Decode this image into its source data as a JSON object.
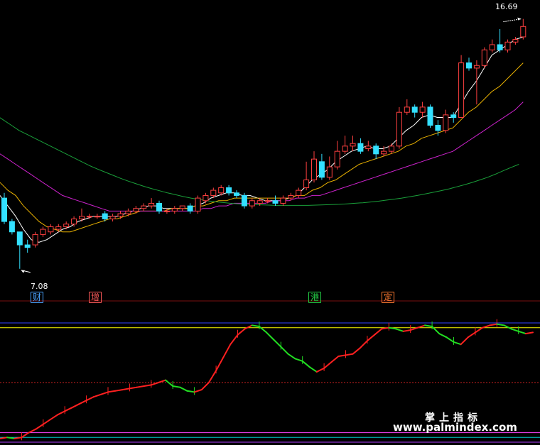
{
  "labels": {
    "high_price": "16.69",
    "low_price": "7.08"
  },
  "tags": [
    {
      "text": "财",
      "color": "#4aa3ff"
    },
    {
      "text": "增",
      "color": "#ff5a5a"
    },
    {
      "text": "港",
      "color": "#22cc44"
    },
    {
      "text": "定",
      "color": "#ff7a30"
    }
  ],
  "watermark": {
    "line1": "掌上指标",
    "line2": "www.palmindex.com"
  },
  "colors": {
    "up": "#ff4040",
    "down": "#33e0ff",
    "ma5": "#ffffff",
    "ma10": "#e8b000",
    "ma20": "#cc22cc",
    "ma60": "#1aa03a",
    "osc_up": "#ff2020",
    "osc_down": "#22dd22",
    "osc_flat": "#2030ff"
  },
  "chart_data": [
    {
      "type": "candlestick",
      "title": "",
      "xlabel": "",
      "ylabel": "",
      "ylim": [
        6.5,
        17.2
      ],
      "grid": false,
      "candles": [
        [
          9.8,
          10.0,
          8.9,
          8.8
        ],
        [
          8.9,
          9.0,
          8.5,
          8.4
        ],
        [
          8.5,
          8.5,
          8.0,
          7.08
        ],
        [
          8.0,
          8.2,
          7.9,
          7.7
        ],
        [
          8.0,
          8.5,
          8.4,
          7.9
        ],
        [
          8.4,
          8.7,
          8.6,
          8.3
        ],
        [
          8.5,
          8.8,
          8.7,
          8.4
        ],
        [
          8.6,
          8.8,
          8.7,
          8.5
        ],
        [
          8.7,
          8.9,
          8.8,
          8.6
        ],
        [
          8.8,
          9.1,
          9.0,
          8.7
        ],
        [
          9.0,
          9.4,
          9.1,
          8.9
        ],
        [
          9.1,
          9.2,
          9.1,
          9.0
        ],
        [
          9.1,
          9.2,
          9.1,
          9.0
        ],
        [
          9.2,
          9.3,
          9.0,
          8.9
        ],
        [
          9.0,
          9.2,
          9.1,
          8.9
        ],
        [
          9.1,
          9.3,
          9.2,
          9.0
        ],
        [
          9.2,
          9.4,
          9.3,
          9.1
        ],
        [
          9.3,
          9.5,
          9.4,
          9.2
        ],
        [
          9.4,
          9.6,
          9.5,
          9.3
        ],
        [
          9.5,
          9.8,
          9.6,
          9.4
        ],
        [
          9.6,
          9.7,
          9.3,
          9.2
        ],
        [
          9.3,
          9.4,
          9.3,
          9.2
        ],
        [
          9.3,
          9.5,
          9.4,
          9.2
        ],
        [
          9.4,
          9.5,
          9.5,
          9.3
        ],
        [
          9.5,
          9.6,
          9.3,
          9.2
        ],
        [
          9.3,
          9.9,
          9.8,
          9.2
        ],
        [
          9.7,
          10.0,
          9.9,
          9.6
        ],
        [
          9.9,
          10.2,
          10.1,
          9.8
        ],
        [
          10.0,
          10.3,
          10.2,
          9.9
        ],
        [
          10.2,
          10.3,
          10.0,
          9.9
        ],
        [
          10.0,
          10.1,
          9.9,
          9.8
        ],
        [
          9.9,
          10.0,
          9.5,
          9.4
        ],
        [
          9.5,
          9.8,
          9.7,
          9.4
        ],
        [
          9.6,
          9.8,
          9.7,
          9.5
        ],
        [
          9.7,
          9.8,
          9.7,
          9.6
        ],
        [
          9.7,
          9.9,
          9.6,
          9.5
        ],
        [
          9.6,
          9.9,
          9.8,
          9.5
        ],
        [
          9.8,
          10.0,
          9.9,
          9.7
        ],
        [
          9.9,
          10.2,
          10.1,
          9.8
        ],
        [
          10.2,
          11.2,
          10.5,
          10.1
        ],
        [
          10.5,
          11.6,
          11.3,
          10.4
        ],
        [
          11.2,
          11.5,
          10.6,
          10.5
        ],
        [
          10.6,
          11.4,
          11.0,
          10.5
        ],
        [
          11.0,
          12.0,
          11.6,
          10.9
        ],
        [
          11.6,
          12.2,
          11.8,
          11.5
        ],
        [
          11.8,
          12.2,
          11.9,
          11.6
        ],
        [
          11.9,
          12.1,
          11.6,
          11.5
        ],
        [
          11.7,
          12.0,
          11.8,
          11.6
        ],
        [
          11.8,
          11.9,
          11.5,
          11.3
        ],
        [
          11.5,
          11.8,
          11.6,
          11.4
        ],
        [
          11.6,
          11.9,
          11.8,
          11.5
        ],
        [
          11.8,
          13.3,
          13.1,
          11.7
        ],
        [
          13.1,
          13.6,
          13.3,
          13.0
        ],
        [
          13.3,
          13.4,
          13.1,
          12.9
        ],
        [
          13.1,
          13.5,
          13.3,
          12.9
        ],
        [
          13.3,
          13.4,
          12.6,
          12.5
        ],
        [
          12.6,
          12.8,
          12.4,
          12.2
        ],
        [
          12.4,
          13.2,
          13.0,
          12.3
        ],
        [
          13.0,
          13.1,
          12.9,
          12.7
        ],
        [
          12.9,
          15.3,
          15.0,
          12.9
        ],
        [
          15.0,
          15.2,
          14.8,
          14.7
        ],
        [
          14.8,
          15.1,
          14.9,
          13.4
        ],
        [
          14.9,
          15.6,
          15.5,
          14.8
        ],
        [
          15.5,
          15.9,
          15.7,
          15.4
        ],
        [
          15.7,
          16.3,
          15.5,
          15.4
        ],
        [
          15.5,
          15.9,
          15.8,
          15.4
        ],
        [
          15.8,
          16.0,
          15.9,
          15.7
        ],
        [
          16.0,
          16.69,
          16.4,
          15.9
        ]
      ],
      "series": [
        {
          "values": [
            9.9,
            9.5,
            9.1,
            8.6,
            8.2,
            8.1,
            8.2,
            8.4,
            8.6,
            8.7,
            8.9,
            9.0,
            9.1,
            9.1,
            9.1,
            9.1,
            9.2,
            9.3,
            9.4,
            9.5,
            9.5,
            9.4,
            9.4,
            9.4,
            9.4,
            9.5,
            9.6,
            9.8,
            9.9,
            10.0,
            10.0,
            9.9,
            9.9,
            9.8,
            9.7,
            9.7,
            9.7,
            9.8,
            9.9,
            10.2,
            10.5,
            10.7,
            10.9,
            11.2,
            11.4,
            11.6,
            11.7,
            11.8,
            11.7,
            11.7,
            11.8,
            12.1,
            12.4,
            12.6,
            12.9,
            13.0,
            12.9,
            12.9,
            12.9,
            13.4,
            13.9,
            14.3,
            14.8,
            15.3,
            15.5,
            15.7,
            15.9,
            16.0
          ]
        },
        {
          "values": [
            10.4,
            10.1,
            9.9,
            9.5,
            9.2,
            8.9,
            8.7,
            8.6,
            8.5,
            8.5,
            8.6,
            8.7,
            8.8,
            8.9,
            9.0,
            9.0,
            9.1,
            9.2,
            9.3,
            9.3,
            9.3,
            9.3,
            9.4,
            9.4,
            9.4,
            9.5,
            9.5,
            9.6,
            9.7,
            9.7,
            9.8,
            9.8,
            9.8,
            9.8,
            9.8,
            9.8,
            9.8,
            9.8,
            9.9,
            9.9,
            10.1,
            10.2,
            10.4,
            10.5,
            10.7,
            10.9,
            11.1,
            11.2,
            11.3,
            11.4,
            11.5,
            11.6,
            11.8,
            11.9,
            12.1,
            12.2,
            12.3,
            12.4,
            12.5,
            12.8,
            13.1,
            13.3,
            13.6,
            13.9,
            14.1,
            14.4,
            14.7,
            15.0
          ]
        },
        {
          "values": [
            11.5,
            11.3,
            11.1,
            10.9,
            10.7,
            10.5,
            10.3,
            10.1,
            9.9,
            9.8,
            9.7,
            9.6,
            9.5,
            9.4,
            9.3,
            9.3,
            9.3,
            9.3,
            9.3,
            9.3,
            9.3,
            9.3,
            9.3,
            9.3,
            9.3,
            9.3,
            9.4,
            9.4,
            9.5,
            9.5,
            9.6,
            9.6,
            9.6,
            9.6,
            9.6,
            9.7,
            9.7,
            9.7,
            9.8,
            9.8,
            9.9,
            9.9,
            10.0,
            10.1,
            10.2,
            10.3,
            10.4,
            10.5,
            10.6,
            10.7,
            10.8,
            10.9,
            11.0,
            11.1,
            11.2,
            11.3,
            11.4,
            11.5,
            11.6,
            11.8,
            12.0,
            12.2,
            12.4,
            12.6,
            12.8,
            13.0,
            13.2,
            13.5
          ]
        },
        {
          "values": [
            13.0,
            12.8,
            12.6,
            12.4,
            12.25,
            12.1,
            11.95,
            11.8,
            11.65,
            11.5,
            11.35,
            11.2,
            11.05,
            10.92,
            10.8,
            10.68,
            10.56,
            10.45,
            10.35,
            10.25,
            10.16,
            10.08,
            10.0,
            9.93,
            9.86,
            9.8,
            9.75,
            9.7,
            9.66,
            9.63,
            9.6,
            9.58,
            9.56,
            9.55,
            9.54,
            9.53,
            9.52,
            9.52,
            9.52,
            9.52,
            9.52,
            9.53,
            9.54,
            9.55,
            9.56,
            9.58,
            9.6,
            9.62,
            9.65,
            9.68,
            9.72,
            9.76,
            9.8,
            9.85,
            9.9,
            9.96,
            10.02,
            10.08,
            10.15,
            10.23,
            10.31,
            10.4,
            10.5,
            10.6,
            10.72,
            10.85,
            10.98,
            11.1
          ]
        }
      ]
    },
    {
      "type": "line",
      "title": "",
      "ylim": [
        0,
        100
      ],
      "reference_lines": [
        {
          "value": 100,
          "color": "#3344ff"
        },
        {
          "value": 96,
          "color": "#ffff00"
        },
        {
          "value": 50,
          "color": "#cc2222"
        },
        {
          "value": 8,
          "color": "#ff44ff"
        },
        {
          "value": 4,
          "color": "#00cccc"
        },
        {
          "value": 0,
          "color": "#b040ff"
        }
      ],
      "values": [
        3,
        4,
        3,
        4,
        8,
        11,
        15,
        19,
        23,
        26,
        29,
        32,
        35,
        38,
        40,
        42,
        43,
        44,
        45,
        46,
        47,
        48,
        50,
        52,
        47,
        46,
        43,
        42,
        44,
        50,
        60,
        71,
        82,
        90,
        95,
        98,
        97,
        92,
        86,
        80,
        74,
        70,
        68,
        63,
        59,
        62,
        67,
        72,
        73,
        74,
        79,
        85,
        90,
        95,
        96,
        95,
        93,
        94,
        96,
        98,
        97,
        91,
        88,
        84,
        82,
        88,
        92,
        96,
        98,
        99,
        98,
        95,
        93,
        91,
        92
      ]
    }
  ]
}
